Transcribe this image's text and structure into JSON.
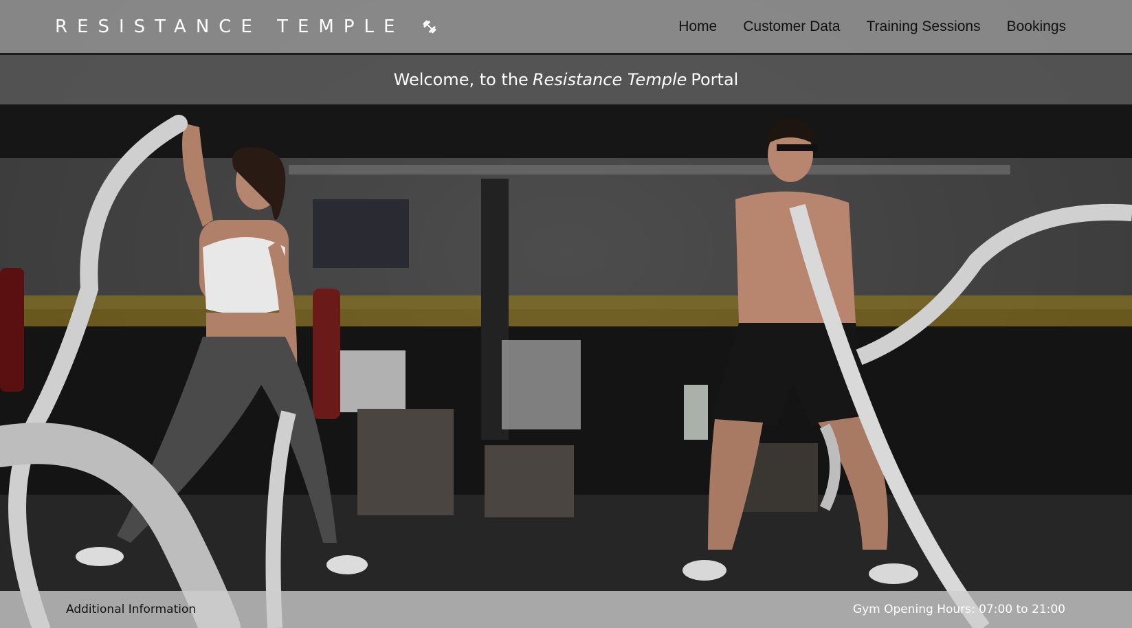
{
  "header": {
    "brand": "RESISTANCE TEMPLE",
    "brand_icon": "dumbbell-icon",
    "nav": [
      {
        "label": "Home"
      },
      {
        "label": "Customer Data"
      },
      {
        "label": "Training Sessions"
      },
      {
        "label": "Bookings"
      }
    ]
  },
  "welcome": {
    "prefix": "Welcome, to the",
    "name": "Resistance Temple",
    "suffix": "Portal"
  },
  "footer": {
    "additional_label": "Additional Information",
    "hours_text": "Gym Opening Hours: 07:00 to 21:00"
  },
  "colors": {
    "topbar": "#969696",
    "welcome_bar": "#585858",
    "footer": "#cdcdcd"
  }
}
